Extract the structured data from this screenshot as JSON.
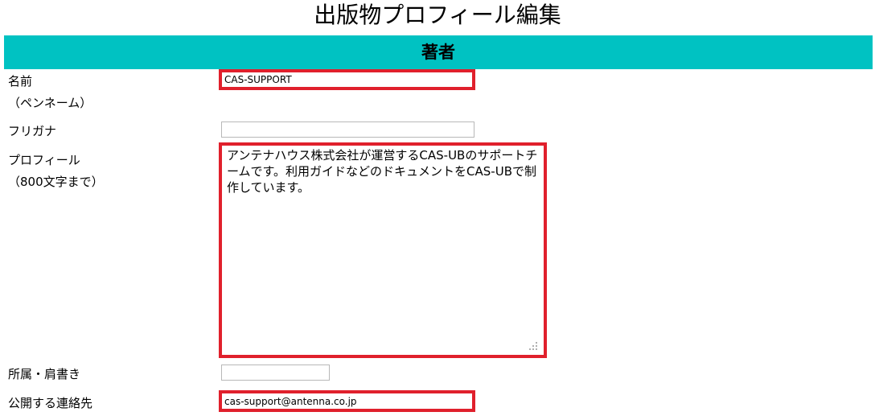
{
  "page_title": "出版物プロフィール編集",
  "section": {
    "title": "著者",
    "color": "#00c2c2"
  },
  "highlight_color": "#e0202c",
  "form": {
    "name": {
      "label_line1": "名前",
      "label_line2": "（ペンネーム）",
      "value": "CAS-SUPPORT"
    },
    "furigana": {
      "label": "フリガナ",
      "value": ""
    },
    "profile": {
      "label_line1": "プロフィール",
      "label_line2": "（800文字まで）",
      "value": "アンテナハウス株式会社が運営するCAS-UBのサポートチームです。利用ガイドなどのドキュメントをCAS-UBで制作しています。"
    },
    "affiliation": {
      "label": "所属・肩書き",
      "value": ""
    },
    "contact": {
      "label": "公開する連絡先",
      "value": "cas-support@antenna.co.jp"
    }
  }
}
